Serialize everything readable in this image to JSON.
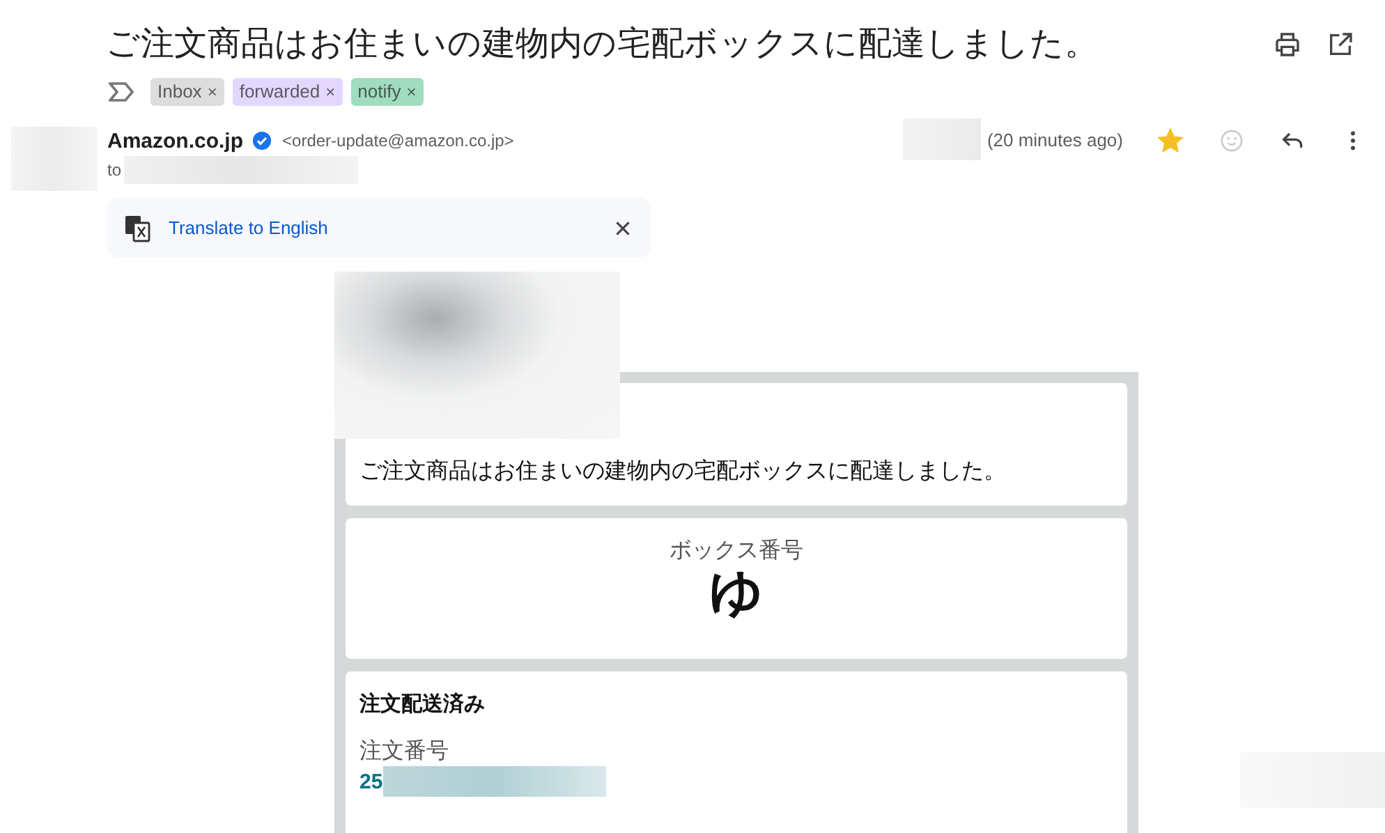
{
  "subject": "ご注文商品はお住まいの建物内の宅配ボックスに配達しました。",
  "labels": [
    {
      "name": "Inbox",
      "color": "#dddddd",
      "remove": "×"
    },
    {
      "name": "forwarded",
      "color": "#e3d7ff",
      "remove": "×"
    },
    {
      "name": "notify",
      "color": "#a0dcbf",
      "remove": "×"
    }
  ],
  "sender": {
    "name": "Amazon.co.jp",
    "verified": true,
    "email": "<order-update@amazon.co.jp>",
    "to": "to",
    "time": "(20 minutes ago)",
    "starred": true
  },
  "translate": {
    "link": "Translate to English"
  },
  "body": {
    "message": "ご注文商品はお住まいの建物内の宅配ボックスに配達しました。",
    "box_label": "ボックス番号",
    "box_number": "ゆ",
    "status": "注文配送済み",
    "order_label": "注文番号",
    "order_number": "25"
  }
}
